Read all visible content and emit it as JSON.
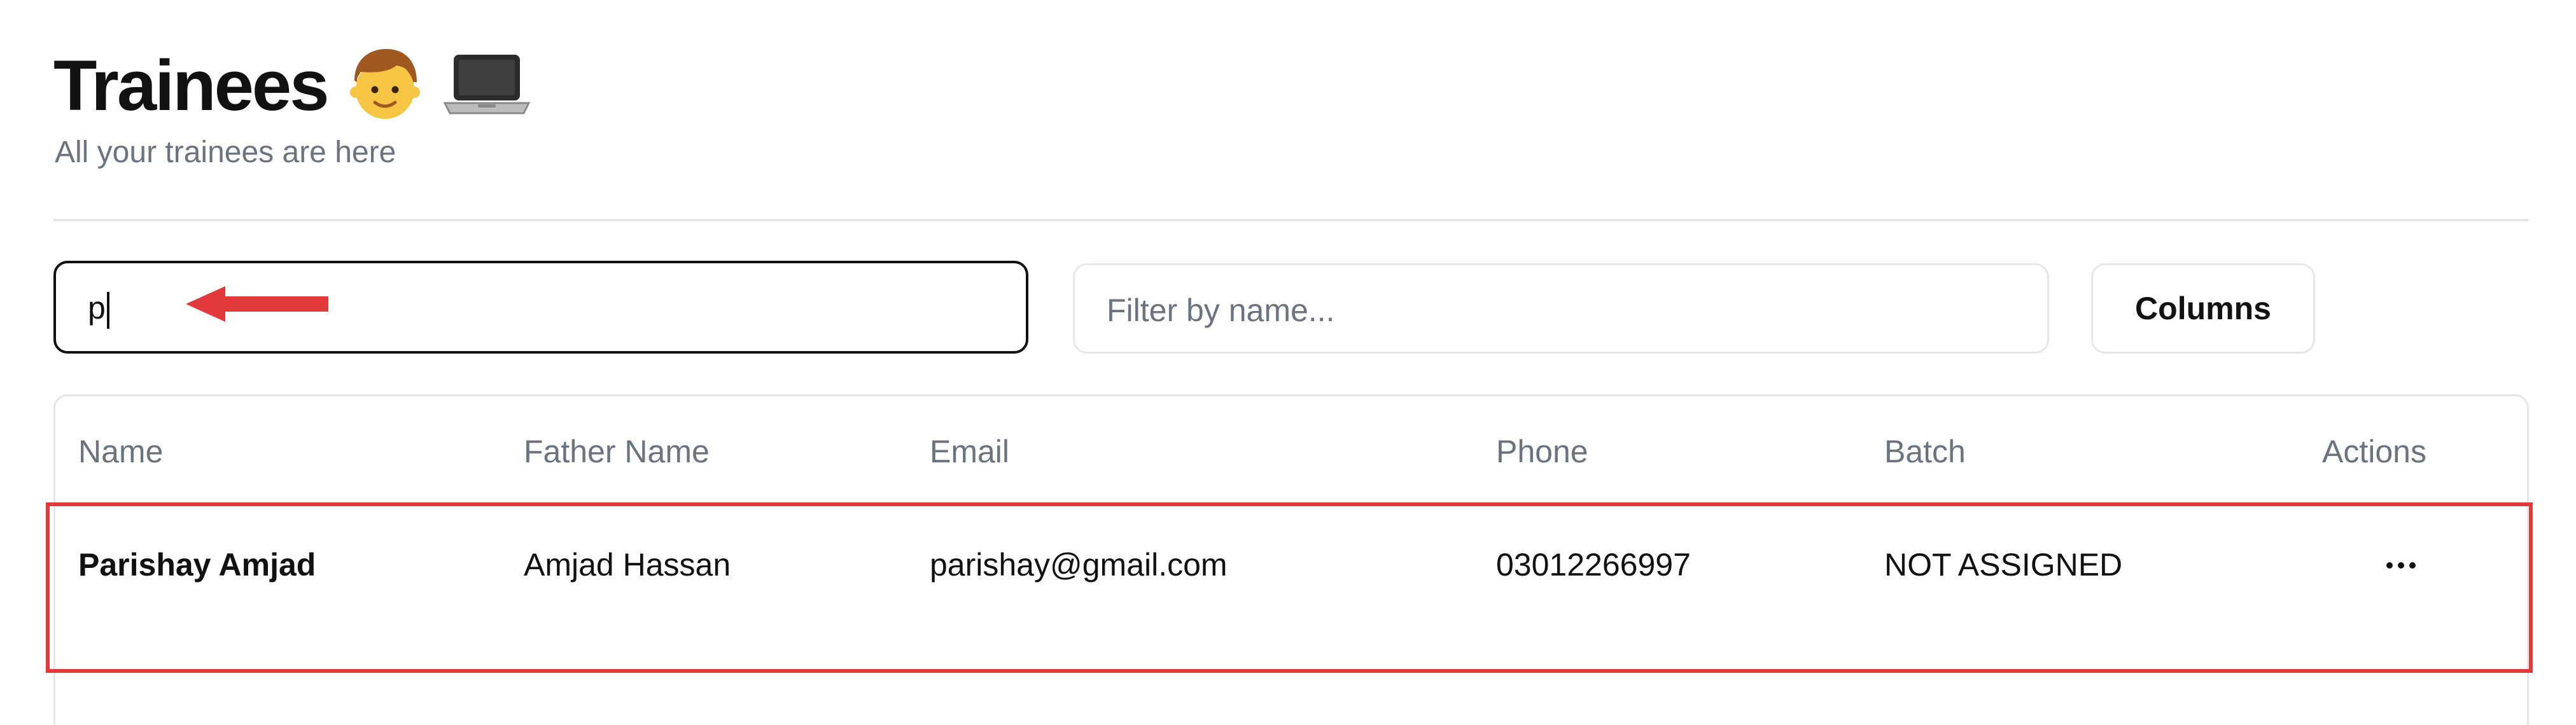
{
  "header": {
    "title": "Trainees",
    "subtitle": "All your trainees are here",
    "title_icons": [
      "boy-emoji-icon",
      "laptop-emoji-icon"
    ]
  },
  "toolbar": {
    "search_value": "p",
    "filter_placeholder": "Filter by name...",
    "columns_label": "Columns"
  },
  "table": {
    "headers": {
      "name": "Name",
      "father_name": "Father Name",
      "email": "Email",
      "phone": "Phone",
      "batch": "Batch",
      "actions": "Actions"
    },
    "rows": [
      {
        "name": "Parishay Amjad",
        "father_name": "Amjad Hassan",
        "email": "parishay@gmail.com",
        "phone": "03012266997",
        "batch": "NOT ASSIGNED",
        "actions_icon": "more-horizontal-icon"
      }
    ]
  },
  "colors": {
    "annotation": "#e23a3a",
    "muted_text": "#6b7280",
    "border": "#e5e7eb"
  }
}
